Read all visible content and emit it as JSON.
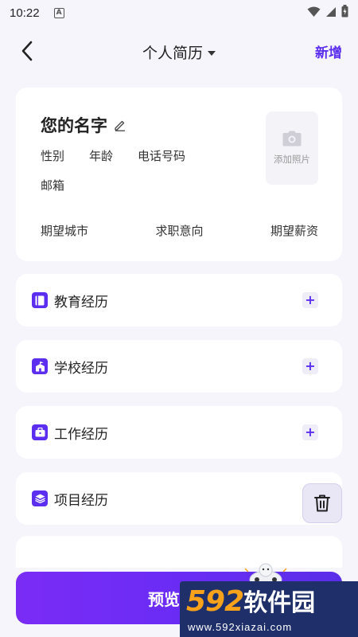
{
  "status_bar": {
    "time": "10:22",
    "notification_icon": "a-icon",
    "icons": [
      "wifi-icon",
      "signal-icon",
      "battery-icon"
    ]
  },
  "header": {
    "title": "个人简历",
    "new_label": "新增"
  },
  "profile": {
    "name": "您的名字",
    "gender_label": "性别",
    "age_label": "年龄",
    "phone_label": "电话号码",
    "email_label": "邮箱",
    "add_photo_label": "添加照片",
    "city_label": "期望城市",
    "intention_label": "求职意向",
    "salary_label": "期望薪资"
  },
  "sections": [
    {
      "label": "教育经历",
      "icon": "book-icon"
    },
    {
      "label": "学校经历",
      "icon": "school-icon"
    },
    {
      "label": "工作经历",
      "icon": "briefcase-icon"
    },
    {
      "label": "项目经历",
      "icon": "layers-icon"
    }
  ],
  "preview_label": "预览",
  "watermark": {
    "brand_num": "592",
    "brand_cn": "软件园",
    "url": "www.592xiazai.com"
  },
  "colors": {
    "accent": "#5b2ef0",
    "background": "#f6f5fb",
    "preview_gradient_start": "#7a2cf5",
    "preview_gradient_end": "#5a2ee8"
  }
}
